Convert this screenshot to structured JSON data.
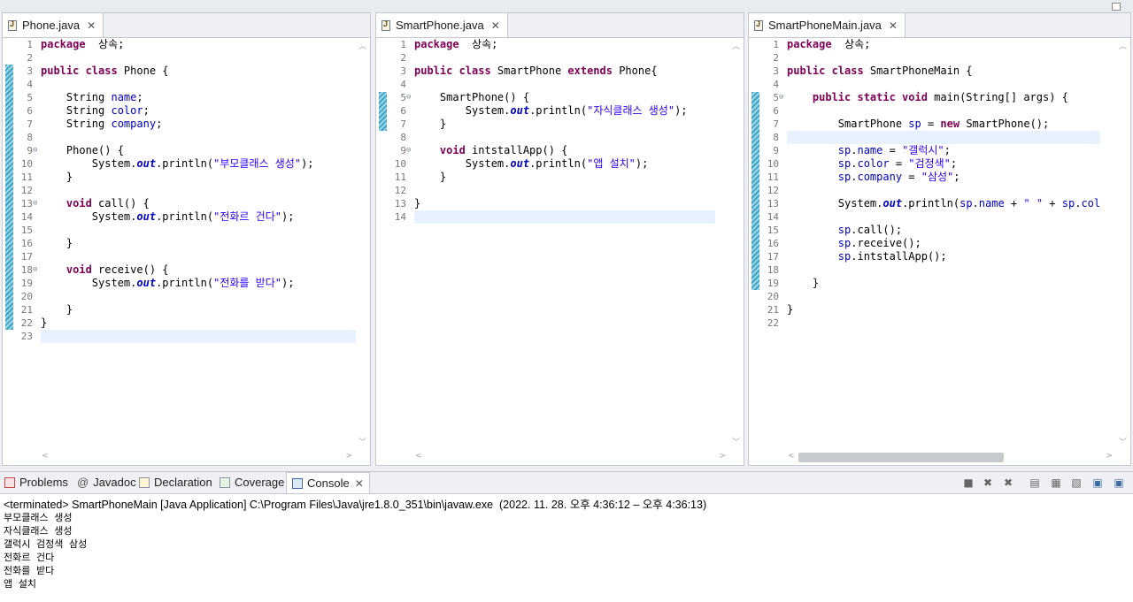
{
  "editors": [
    {
      "tab_label": "Phone.java",
      "line_numbers": [
        "1",
        "2",
        "3",
        "4",
        "5",
        "6",
        "7",
        "8",
        "9",
        "10",
        "11",
        "12",
        "13",
        "14",
        "15",
        "16",
        "17",
        "18",
        "19",
        "20",
        "21",
        "22",
        "23"
      ],
      "lines": [
        [
          [
            "kw",
            "package"
          ],
          [
            "",
            "  상속;"
          ]
        ],
        [],
        [
          [
            "kw",
            "public class"
          ],
          [
            "",
            " Phone {"
          ]
        ],
        [],
        [
          [
            "",
            "    String "
          ],
          [
            "fld",
            "name"
          ],
          [
            "",
            ";"
          ]
        ],
        [
          [
            "",
            "    String "
          ],
          [
            "fld",
            "color"
          ],
          [
            "",
            ";"
          ]
        ],
        [
          [
            "",
            "    String "
          ],
          [
            "fld",
            "company"
          ],
          [
            "",
            ";"
          ]
        ],
        [],
        [
          [
            "",
            "    Phone() {"
          ]
        ],
        [
          [
            "",
            "        System."
          ],
          [
            "ital",
            "out"
          ],
          [
            "",
            ".println("
          ],
          [
            "str",
            "\"부모클래스 생성\""
          ],
          [
            "",
            ");"
          ]
        ],
        [
          [
            "",
            "    }"
          ]
        ],
        [],
        [
          [
            "",
            "    "
          ],
          [
            "kw",
            "void"
          ],
          [
            "",
            " call() {"
          ]
        ],
        [
          [
            "",
            "        System."
          ],
          [
            "ital",
            "out"
          ],
          [
            "",
            ".println("
          ],
          [
            "str",
            "\"전화르 건다\""
          ],
          [
            "",
            ");"
          ]
        ],
        [],
        [
          [
            "",
            "    }"
          ]
        ],
        [],
        [
          [
            "",
            "    "
          ],
          [
            "kw",
            "void"
          ],
          [
            "",
            " receive() {"
          ]
        ],
        [
          [
            "",
            "        System."
          ],
          [
            "ital",
            "out"
          ],
          [
            "",
            ".println("
          ],
          [
            "str",
            "\"전화를 받다\""
          ],
          [
            "",
            ");"
          ]
        ],
        [],
        [
          [
            "",
            "    }"
          ]
        ],
        [
          [
            "",
            "}"
          ]
        ],
        []
      ]
    },
    {
      "tab_label": "SmartPhone.java",
      "line_numbers": [
        "1",
        "2",
        "3",
        "4",
        "5",
        "6",
        "7",
        "8",
        "9",
        "10",
        "11",
        "12",
        "13",
        "14"
      ],
      "lines": [
        [
          [
            "kw",
            "package"
          ],
          [
            "",
            "  상속;"
          ]
        ],
        [],
        [
          [
            "kw",
            "public class"
          ],
          [
            "",
            " SmartPhone "
          ],
          [
            "kw",
            "extends"
          ],
          [
            "",
            " Phone{"
          ]
        ],
        [],
        [
          [
            "",
            "    SmartPhone() {"
          ]
        ],
        [
          [
            "",
            "        System."
          ],
          [
            "ital",
            "out"
          ],
          [
            "",
            ".println("
          ],
          [
            "str",
            "\"자식클래스 생성\""
          ],
          [
            "",
            ");"
          ]
        ],
        [
          [
            "",
            "    }"
          ]
        ],
        [],
        [
          [
            "",
            "    "
          ],
          [
            "kw",
            "void"
          ],
          [
            "",
            " intstallApp() {"
          ]
        ],
        [
          [
            "",
            "        System."
          ],
          [
            "ital",
            "out"
          ],
          [
            "",
            ".println("
          ],
          [
            "str",
            "\"앱 설치\""
          ],
          [
            "",
            ");"
          ]
        ],
        [
          [
            "",
            "    }"
          ]
        ],
        [],
        [
          [
            "",
            "}"
          ]
        ],
        []
      ]
    },
    {
      "tab_label": "SmartPhoneMain.java",
      "line_numbers": [
        "1",
        "2",
        "3",
        "4",
        "5",
        "6",
        "7",
        "8",
        "9",
        "10",
        "11",
        "12",
        "13",
        "14",
        "15",
        "16",
        "17",
        "18",
        "19",
        "20",
        "21",
        "22"
      ],
      "lines": [
        [
          [
            "kw",
            "package"
          ],
          [
            "",
            "  상속;"
          ]
        ],
        [],
        [
          [
            "kw",
            "public class"
          ],
          [
            "",
            " SmartPhoneMain {"
          ]
        ],
        [],
        [
          [
            "",
            "    "
          ],
          [
            "kw",
            "public static void"
          ],
          [
            "",
            " main(String[] args) {"
          ]
        ],
        [],
        [
          [
            "",
            "        SmartPhone "
          ],
          [
            "fld",
            "sp"
          ],
          [
            "",
            " = "
          ],
          [
            "kw",
            "new"
          ],
          [
            "",
            " SmartPhone();"
          ]
        ],
        [],
        [
          [
            "",
            "        "
          ],
          [
            "fld",
            "sp"
          ],
          [
            "",
            "."
          ],
          [
            "fld",
            "name"
          ],
          [
            "",
            " = "
          ],
          [
            "str",
            "\"갤럭시\""
          ],
          [
            "",
            ";"
          ]
        ],
        [
          [
            "",
            "        "
          ],
          [
            "fld",
            "sp"
          ],
          [
            "",
            "."
          ],
          [
            "fld",
            "color"
          ],
          [
            "",
            " = "
          ],
          [
            "str",
            "\"검정색\""
          ],
          [
            "",
            ";"
          ]
        ],
        [
          [
            "",
            "        "
          ],
          [
            "fld",
            "sp"
          ],
          [
            "",
            "."
          ],
          [
            "fld",
            "company"
          ],
          [
            "",
            " = "
          ],
          [
            "str",
            "\"삼성\""
          ],
          [
            "",
            ";"
          ]
        ],
        [],
        [
          [
            "",
            "        System."
          ],
          [
            "ital",
            "out"
          ],
          [
            "",
            ".println("
          ],
          [
            "fld",
            "sp"
          ],
          [
            "",
            "."
          ],
          [
            "fld",
            "name"
          ],
          [
            "",
            " + "
          ],
          [
            "str",
            "\" \""
          ],
          [
            "",
            " + "
          ],
          [
            "fld",
            "sp"
          ],
          [
            "",
            "."
          ],
          [
            "fld",
            "color"
          ]
        ],
        [],
        [
          [
            "",
            "        "
          ],
          [
            "fld",
            "sp"
          ],
          [
            "",
            ".call();"
          ]
        ],
        [
          [
            "",
            "        "
          ],
          [
            "fld",
            "sp"
          ],
          [
            "",
            ".receive();"
          ]
        ],
        [
          [
            "",
            "        "
          ],
          [
            "fld",
            "sp"
          ],
          [
            "",
            ".intstallApp();"
          ]
        ],
        [],
        [
          [
            "",
            "    }"
          ]
        ],
        [],
        [
          [
            "",
            "}"
          ]
        ],
        []
      ]
    }
  ],
  "console": {
    "tabs": [
      "Problems",
      "Javadoc",
      "Declaration",
      "Coverage",
      "Console"
    ],
    "active_tab": "Console",
    "terminated_line": "<terminated> SmartPhoneMain [Java Application] C:\\Program Files\\Java\\jre1.8.0_351\\bin\\javaw.exe  (2022. 11. 28. 오후 4:36:12 – 오후 4:36:13)",
    "output": [
      "부모클래스 생성",
      "자식클래스 생성",
      "갤럭시 검정색 삼성",
      "전화르 건다",
      "전화를 받다",
      "앱 설치"
    ]
  }
}
